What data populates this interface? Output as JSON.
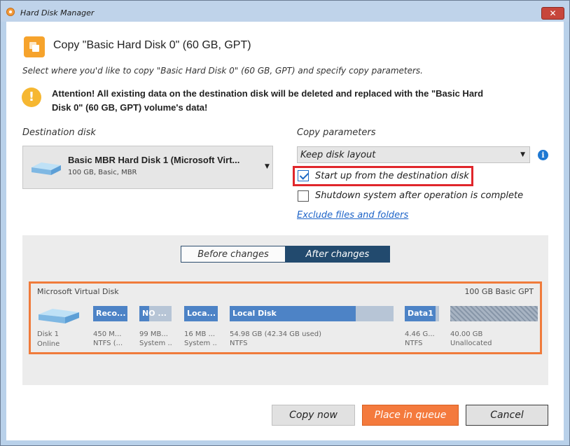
{
  "window": {
    "title": "Hard Disk Manager",
    "close_glyph": "✕"
  },
  "dialog": {
    "title": "Copy \"Basic Hard Disk 0\" (60 GB, GPT)",
    "subtitle": "Select where you'd like to copy \"Basic Hard Disk 0\" (60 GB, GPT) and specify copy parameters.",
    "warning_line1": "Attention! All existing data on the destination disk will be deleted and replaced with the \"Basic Hard",
    "warning_line2": "Disk 0\" (60 GB, GPT) volume's data!",
    "warning_glyph": "!"
  },
  "destination": {
    "label": "Destination disk",
    "selected_name": "Basic MBR Hard Disk 1 (Microsoft Virt...",
    "selected_detail": "100 GB, Basic, MBR",
    "arrow": "▼"
  },
  "params": {
    "label": "Copy parameters",
    "layout_value": "Keep disk layout",
    "arrow": "▼",
    "info_glyph": "i",
    "startup_label": "Start up from the destination disk",
    "startup_checked": true,
    "shutdown_label": "Shutdown system after operation is complete",
    "shutdown_checked": false,
    "exclude_link": "Exclude files and folders"
  },
  "view_toggle": {
    "before": "Before changes",
    "after": "After changes",
    "active": "after"
  },
  "disk_map": {
    "header_left": "Microsoft Virtual Disk",
    "header_right": "100 GB Basic GPT",
    "disk_label": "Disk 1",
    "disk_status": "Online",
    "partitions": [
      {
        "name": "Reco...",
        "size": "450 M...",
        "fs": "NTFS (...",
        "used_fraction": 1.0,
        "unallocated": false
      },
      {
        "name": "NO ...",
        "size": "99 MB...",
        "fs": "System ...",
        "used_fraction": 0.3,
        "unallocated": false
      },
      {
        "name": "Loca...",
        "size": "16 MB ...",
        "fs": "System ...",
        "used_fraction": 1.0,
        "unallocated": false
      },
      {
        "name": "Local Disk",
        "size": "54.98 GB (42.34 GB used)",
        "fs": "NTFS",
        "used_fraction": 0.77,
        "unallocated": false
      },
      {
        "name": "Data1",
        "size": "4.46 G...",
        "fs": "NTFS",
        "used_fraction": 0.9,
        "unallocated": false
      },
      {
        "name": "",
        "size": "40.00 GB",
        "fs": "Unallocated",
        "used_fraction": 0,
        "unallocated": true
      }
    ]
  },
  "buttons": {
    "copy_now": "Copy now",
    "place_in_queue": "Place in queue",
    "cancel": "Cancel"
  },
  "colors": {
    "accent_orange": "#f47a3d",
    "highlight_red": "#e0262b",
    "partition_blue": "#4d83c6",
    "toggle_active": "#224a6e"
  }
}
